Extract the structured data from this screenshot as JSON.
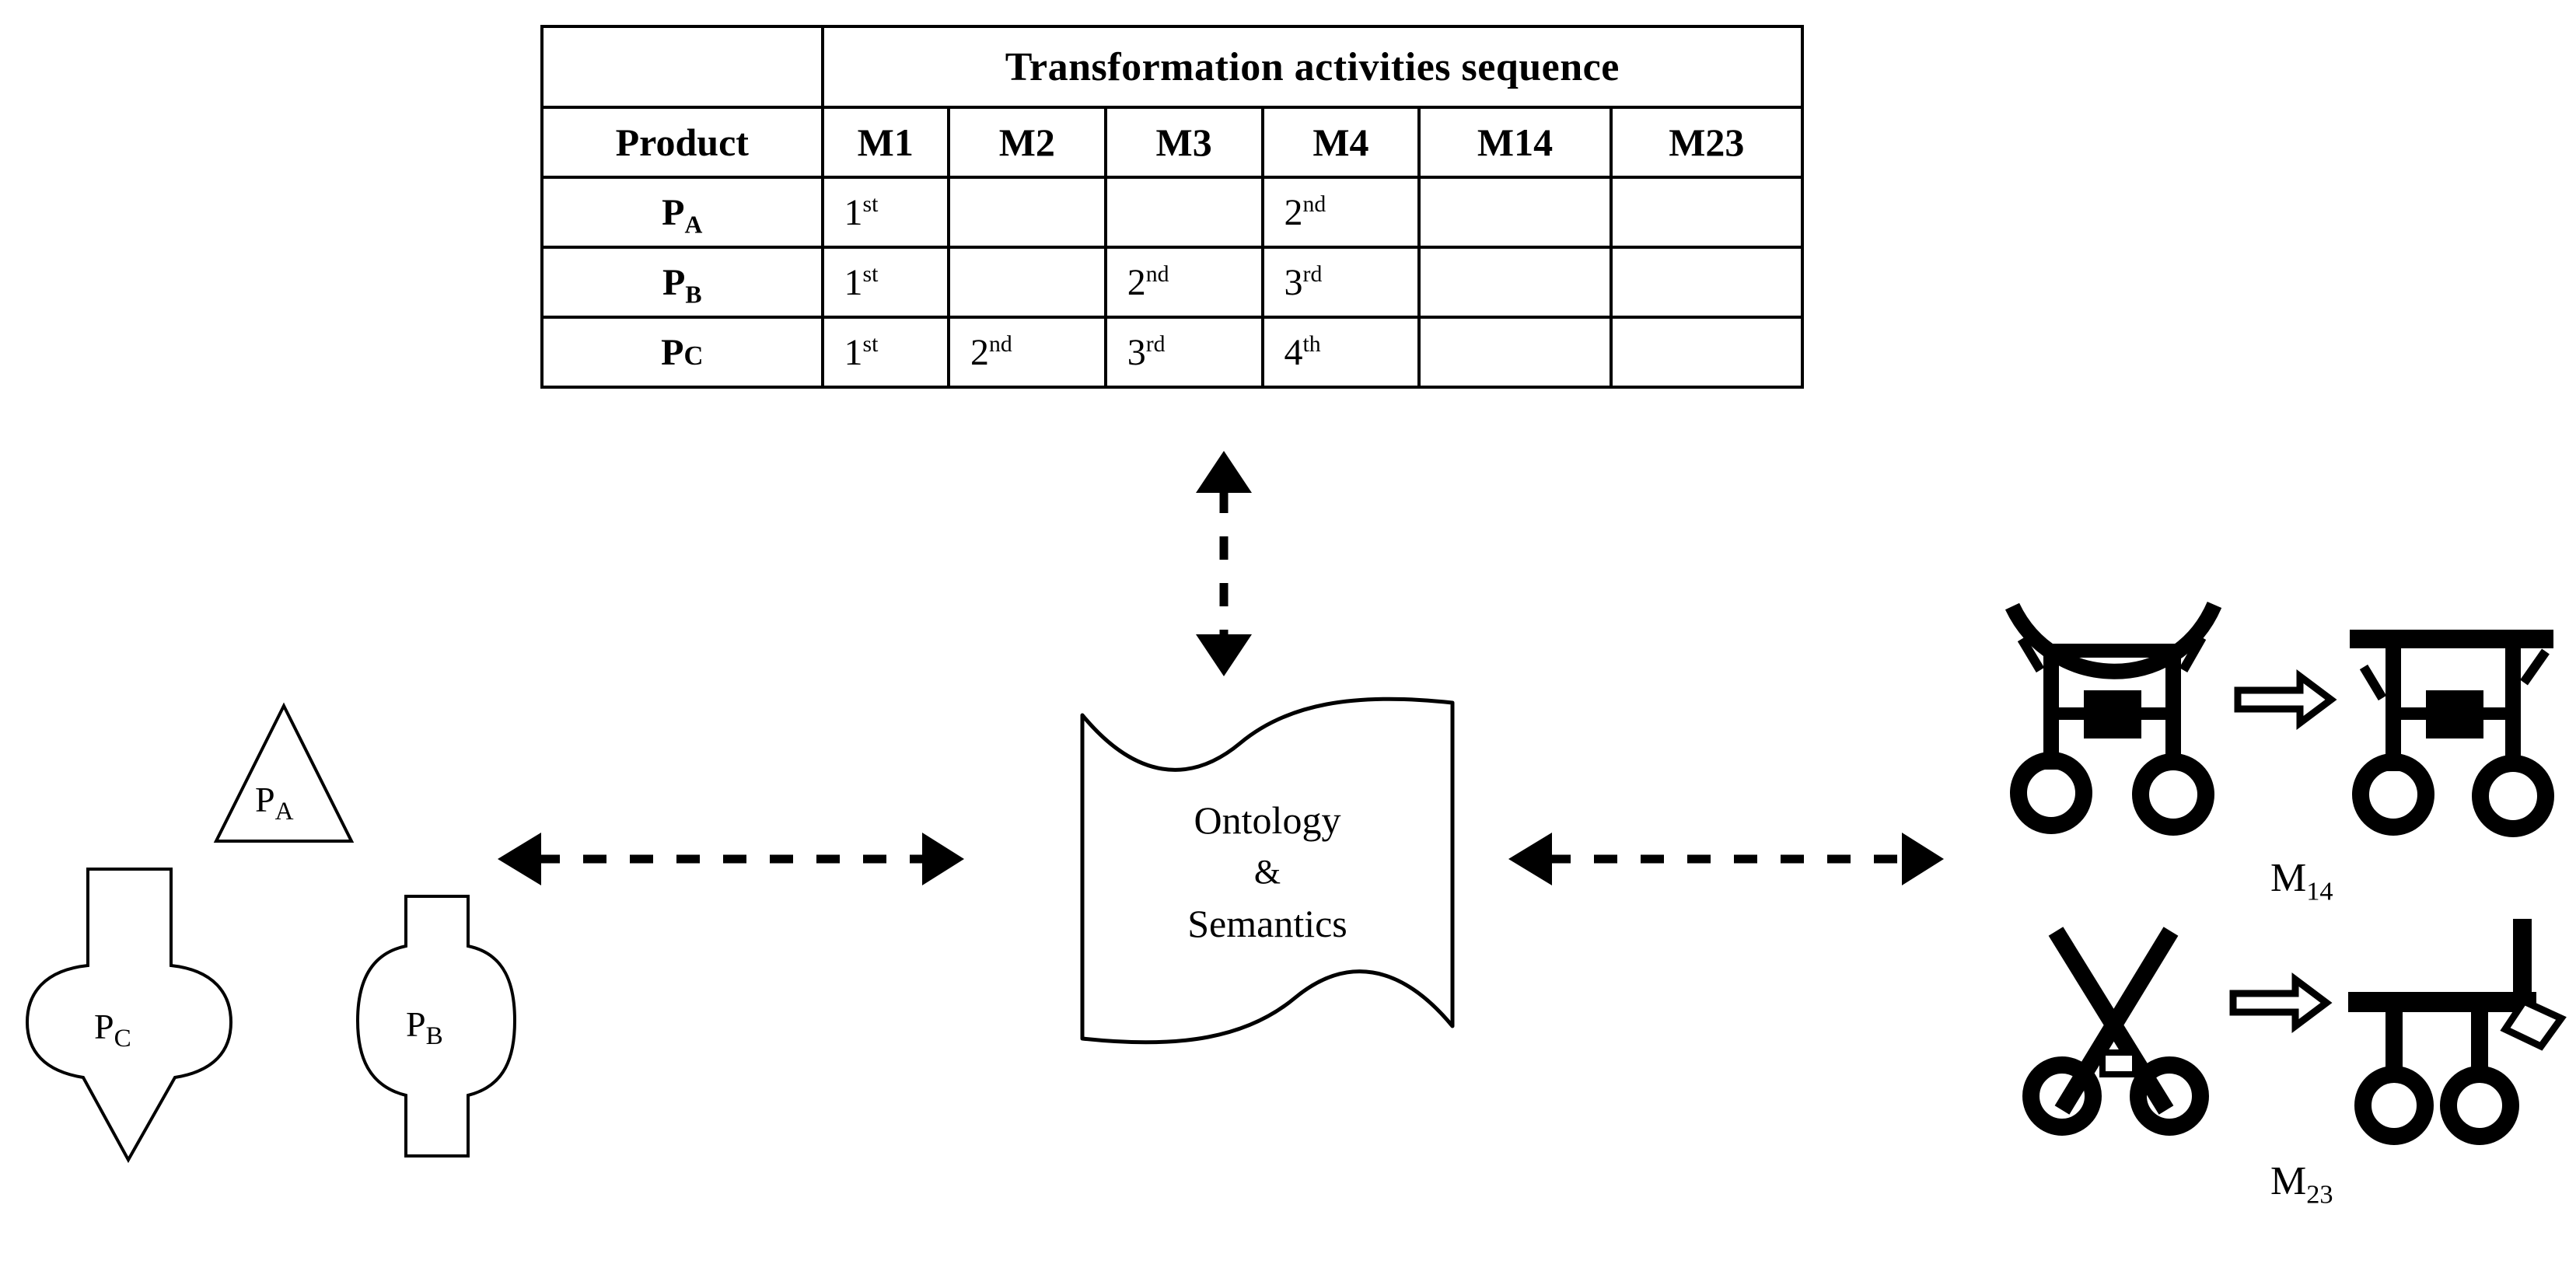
{
  "table": {
    "header_title": "Transformation activities sequence",
    "product_header": "Product",
    "machine_columns": [
      "M1",
      "M2",
      "M3",
      "M4",
      "M14",
      "M23"
    ],
    "rows": [
      {
        "product": "P",
        "product_sub": "A",
        "cells": [
          {
            "n": "1",
            "o": "st"
          },
          {
            "n": "",
            "o": ""
          },
          {
            "n": "",
            "o": ""
          },
          {
            "n": "2",
            "o": "nd"
          },
          {
            "n": "",
            "o": ""
          },
          {
            "n": "",
            "o": ""
          }
        ]
      },
      {
        "product": "P",
        "product_sub": "B",
        "cells": [
          {
            "n": "1",
            "o": "st"
          },
          {
            "n": "",
            "o": ""
          },
          {
            "n": "2",
            "o": "nd"
          },
          {
            "n": "3",
            "o": "rd"
          },
          {
            "n": "",
            "o": ""
          },
          {
            "n": "",
            "o": ""
          }
        ]
      },
      {
        "product": "P",
        "product_sub": "C",
        "cells": [
          {
            "n": "1",
            "o": "st"
          },
          {
            "n": "2",
            "o": "nd"
          },
          {
            "n": "3",
            "o": "rd"
          },
          {
            "n": "4",
            "o": "th"
          },
          {
            "n": "",
            "o": ""
          },
          {
            "n": "",
            "o": ""
          }
        ]
      }
    ]
  },
  "center": {
    "line1": "Ontology",
    "line2": "&",
    "line3": "Semantics"
  },
  "products": [
    {
      "id": "PA",
      "letter": "P",
      "sub": "A",
      "shape": "triangle"
    },
    {
      "id": "PC",
      "letter": "P",
      "sub": "C",
      "shape": "rect-round-point"
    },
    {
      "id": "PB",
      "letter": "P",
      "sub": "B",
      "shape": "rect-circle-rect"
    }
  ],
  "machines": [
    {
      "id": "M14",
      "letter": "M",
      "sub": "14",
      "source": "curved-bar-gantry",
      "target": "straight-bar-gantry"
    },
    {
      "id": "M23",
      "letter": "M",
      "sub": "23",
      "source": "v-scissor-machine",
      "target": "flat-bar-machine"
    }
  ],
  "arrows": [
    {
      "id": "table-to-center",
      "orientation": "vertical",
      "style": "dashed",
      "heads": "both"
    },
    {
      "id": "products-to-center",
      "orientation": "horizontal",
      "style": "dashed",
      "heads": "both"
    },
    {
      "id": "center-to-machines",
      "orientation": "horizontal",
      "style": "dashed",
      "heads": "both"
    }
  ],
  "colors": {
    "ink": "#000000",
    "background": "#ffffff"
  }
}
